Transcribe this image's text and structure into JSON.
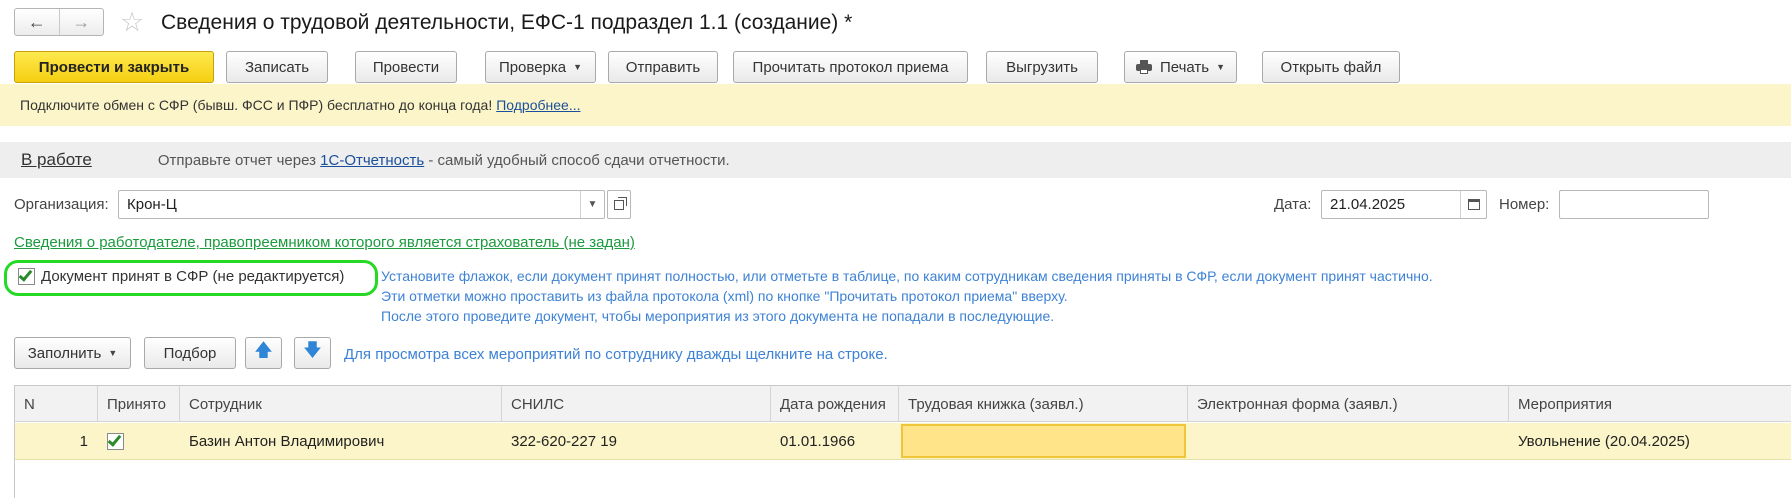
{
  "window": {
    "title": "Сведения о трудовой деятельности, ЕФС-1 подраздел 1.1 (создание) *",
    "back_icon": "←",
    "forward_icon": "→",
    "star_icon": "☆"
  },
  "toolbar": {
    "post_close": "Провести и закрыть",
    "save": "Записать",
    "post": "Провести",
    "check": "Проверка",
    "send": "Отправить",
    "read_protocol": "Прочитать протокол приема",
    "export": "Выгрузить",
    "print": "Печать",
    "open_file": "Открыть файл"
  },
  "notice": {
    "text": "Подключите обмен с СФР (бывш. ФСС и ПФР) бесплатно до конца года!",
    "link": "Подробнее..."
  },
  "status": {
    "state": "В работе",
    "text_before": "Отправьте отчет через ",
    "link": "1С-Отчетность",
    "text_after": " - самый удобный способ сдачи отчетности."
  },
  "form": {
    "org_label": "Организация:",
    "org_value": "Крон-Ц",
    "date_label": "Дата:",
    "date_value": "21.04.2025",
    "number_label": "Номер:",
    "number_value": "",
    "employer_link": "Сведения о работодателе, правопреемником которого является страхователь (не задан)",
    "accepted_label": "Документ принят в СФР (не редактируется)",
    "accepted_checked": true,
    "hint_lines": [
      "Установите флажок, если документ принят полностью, или отметьте в таблице, по каким сотрудникам сведения приняты в СФР, если документ принят частично.",
      "Эти отметки можно проставить из файла протокола (xml) по кнопке \"Прочитать протокол приема\" вверху.",
      "После этого проведите документ, чтобы мероприятия из этого документа не попадали в последующие."
    ]
  },
  "table_toolbar": {
    "fill": "Заполнить",
    "select": "Подбор",
    "up_icon": "🡅",
    "down_icon": "🡇",
    "hint": "Для просмотра всех мероприятий по сотруднику дважды щелкните на строке."
  },
  "table": {
    "columns": [
      "N",
      "Принято",
      "Сотрудник",
      "СНИЛС",
      "Дата рождения",
      "Трудовая книжка (заявл.)",
      "Электронная форма (заявл.)",
      "Мероприятия"
    ],
    "rows": [
      {
        "n": "1",
        "accepted": true,
        "employee": "Базин Антон Владимирович",
        "snils": "322-620-227 19",
        "birth_date": "01.01.1966",
        "work_book": "",
        "electronic_form": "",
        "events": "Увольнение (20.04.2025)"
      }
    ]
  },
  "colors": {
    "primary_button": "#f5cf10",
    "notice_bg": "#fbf5c9",
    "highlight": "#25d925",
    "hint_text": "#3d82d6",
    "link": "#1a4f9c",
    "green_link": "#1b9b3e"
  }
}
